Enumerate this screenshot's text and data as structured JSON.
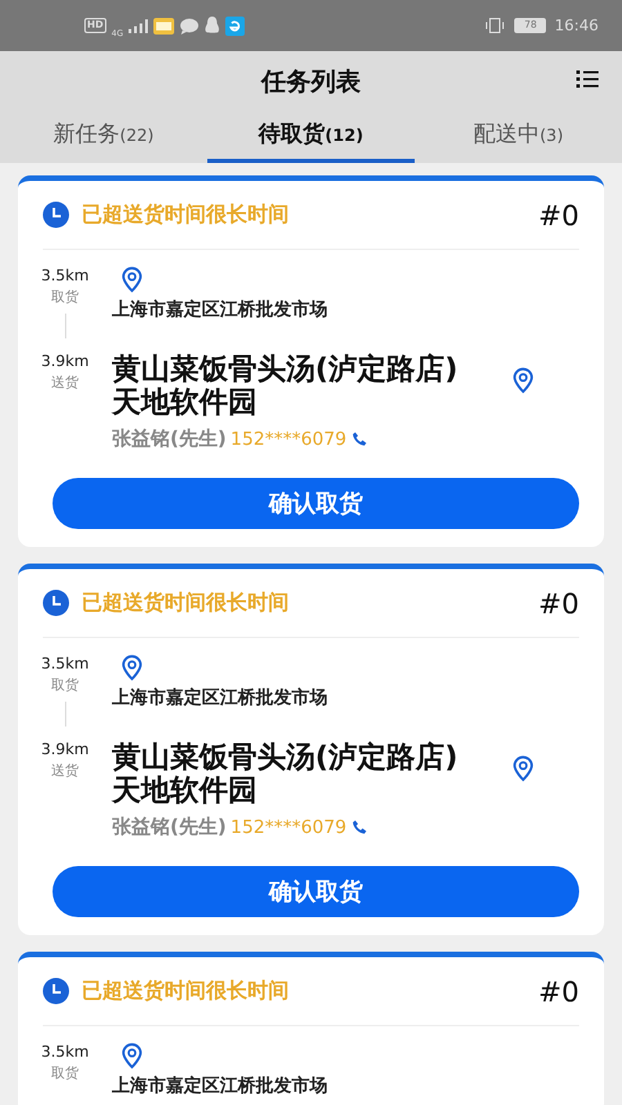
{
  "status_bar": {
    "hd": "HD",
    "network": "4G",
    "battery": "78",
    "time": "16:46"
  },
  "header": {
    "title": "任务列表"
  },
  "tabs": [
    {
      "label": "新任务",
      "count": "(22)",
      "selected": false
    },
    {
      "label": "待取货",
      "count": "(12)",
      "selected": true
    },
    {
      "label": "配送中",
      "count": "(3)",
      "selected": false
    }
  ],
  "orders": [
    {
      "status": "已超送货时间很长时间",
      "number": "#0",
      "pickup": {
        "distance": "3.5km",
        "label": "取货",
        "address": "上海市嘉定区江桥批发市场"
      },
      "delivery": {
        "distance": "3.9km",
        "label": "送货",
        "address": "黄山菜饭骨头汤(泸定路店)天地软件园",
        "contact": "张益铭(先生)",
        "phone": "152****6079"
      },
      "button": "确认取货"
    },
    {
      "status": "已超送货时间很长时间",
      "number": "#0",
      "pickup": {
        "distance": "3.5km",
        "label": "取货",
        "address": "上海市嘉定区江桥批发市场"
      },
      "delivery": {
        "distance": "3.9km",
        "label": "送货",
        "address": "黄山菜饭骨头汤(泸定路店)天地软件园",
        "contact": "张益铭(先生)",
        "phone": "152****6079"
      },
      "button": "确认取货"
    },
    {
      "status": "已超送货时间很长时间",
      "number": "#0",
      "pickup": {
        "distance": "3.5km",
        "label": "取货",
        "address": "上海市嘉定区江桥批发市场"
      }
    }
  ]
}
